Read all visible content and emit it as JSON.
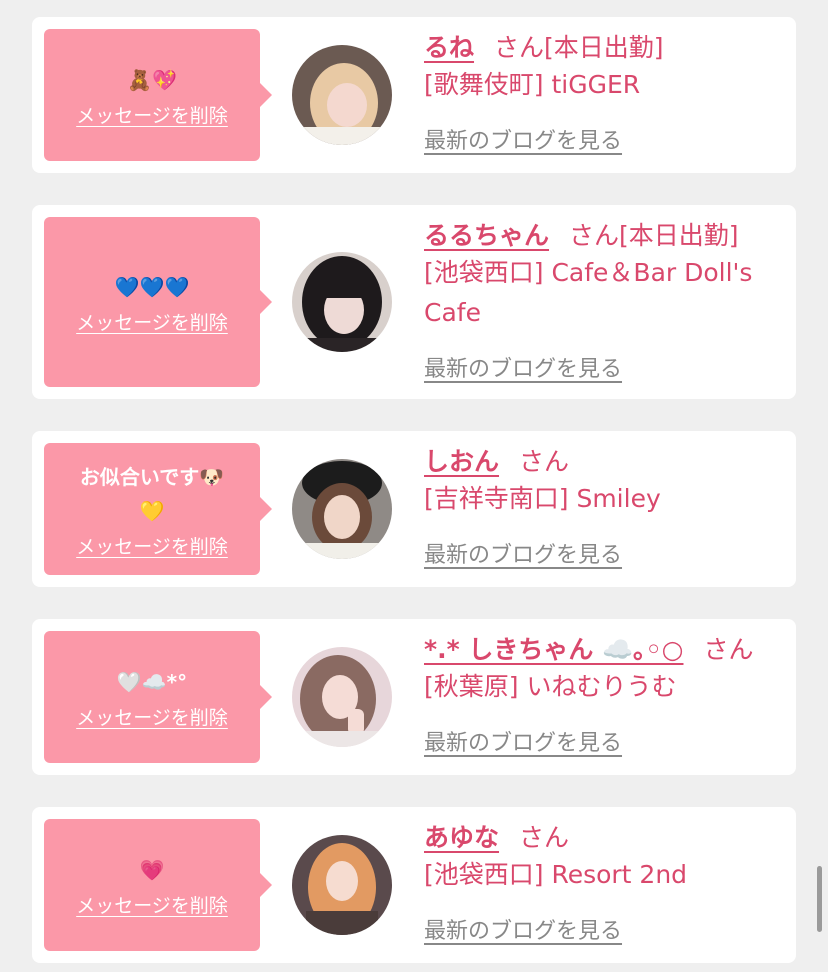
{
  "delete_label": "メッセージを削除",
  "blog_label": "最新のブログを見る",
  "colors": {
    "bubble": "#fb98a8",
    "name": "#d9486c",
    "link": "#888888",
    "background": "#efefef"
  },
  "cards": [
    {
      "message": "🧸💖",
      "name": "るね",
      "suffix": "さん[本日出勤]",
      "shop": "[歌舞伎町] tiGGER"
    },
    {
      "message": "💙💙💙",
      "name": "るるちゃん",
      "suffix": "さん[本日出勤]",
      "shop": "[池袋西口] Cafe＆Bar Doll's Cafe"
    },
    {
      "message": "お似合いです🐶 💛",
      "name": "しおん",
      "suffix": "さん",
      "shop": "[吉祥寺南口] Smiley"
    },
    {
      "message": "🤍☁️*°",
      "name": "*.* しきちゃん ☁️｡◦○",
      "suffix": "さん",
      "shop": "[秋葉原] いねむりうむ"
    },
    {
      "message": "💗",
      "name": "あゆな",
      "suffix": "さん",
      "shop": "[池袋西口] Resort 2nd"
    }
  ]
}
